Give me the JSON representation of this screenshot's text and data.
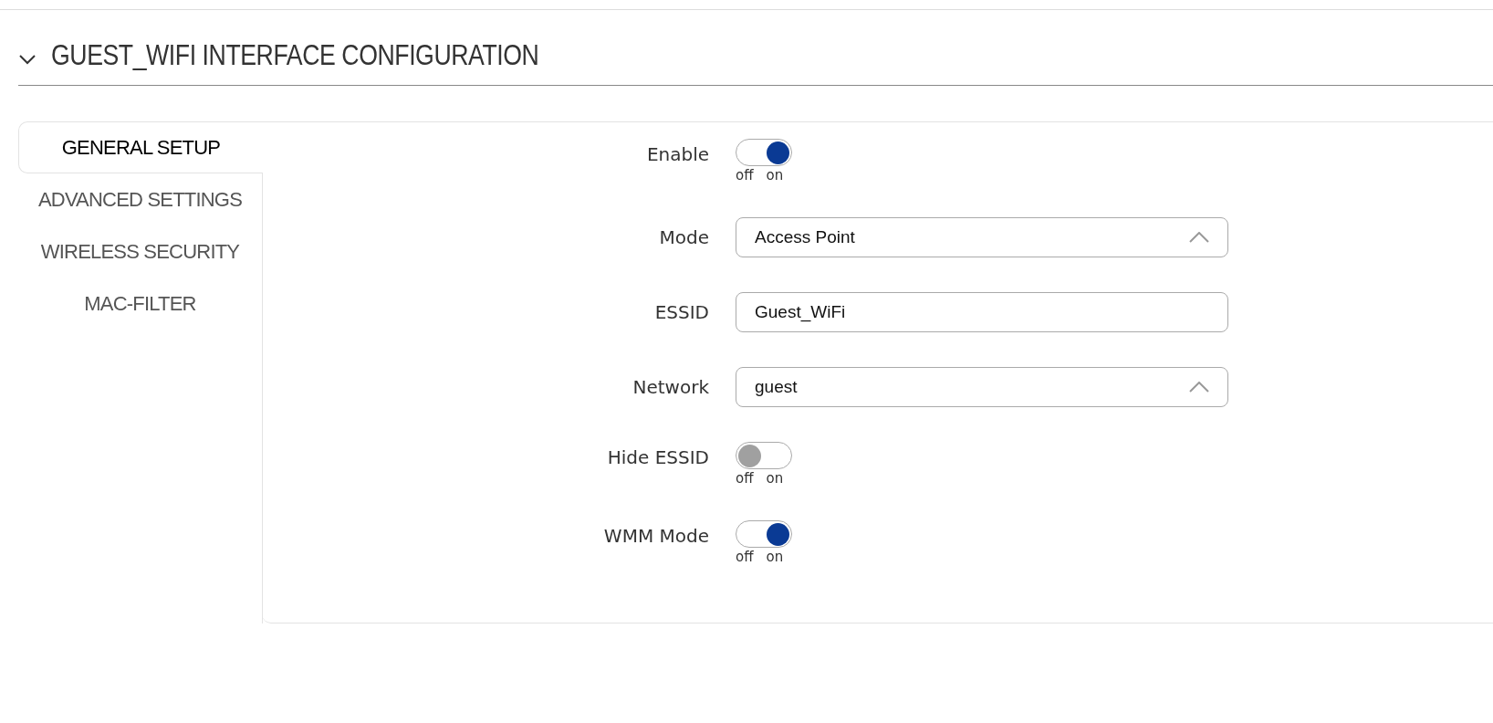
{
  "section": {
    "title": "GUEST_WIFI INTERFACE CONFIGURATION",
    "expanded": true
  },
  "tabs": [
    {
      "label": "GENERAL SETUP",
      "selected": true
    },
    {
      "label": "ADVANCED SETTINGS",
      "selected": false
    },
    {
      "label": "WIRELESS SECURITY",
      "selected": false
    },
    {
      "label": "MAC-FILTER",
      "selected": false
    }
  ],
  "fields": [
    {
      "label": "Enable",
      "kind": "toggle",
      "on": true,
      "off_label": "off",
      "on_label": "on"
    },
    {
      "label": "Mode",
      "kind": "select",
      "value": "Access Point"
    },
    {
      "label": "ESSID",
      "kind": "text",
      "value": "Guest_WiFi"
    },
    {
      "label": "Network",
      "kind": "select",
      "value": "guest"
    },
    {
      "label": "Hide ESSID",
      "kind": "toggle",
      "on": false,
      "off_label": "off",
      "on_label": "on"
    },
    {
      "label": "WMM Mode",
      "kind": "toggle",
      "on": true,
      "off_label": "off",
      "on_label": "on"
    }
  ]
}
